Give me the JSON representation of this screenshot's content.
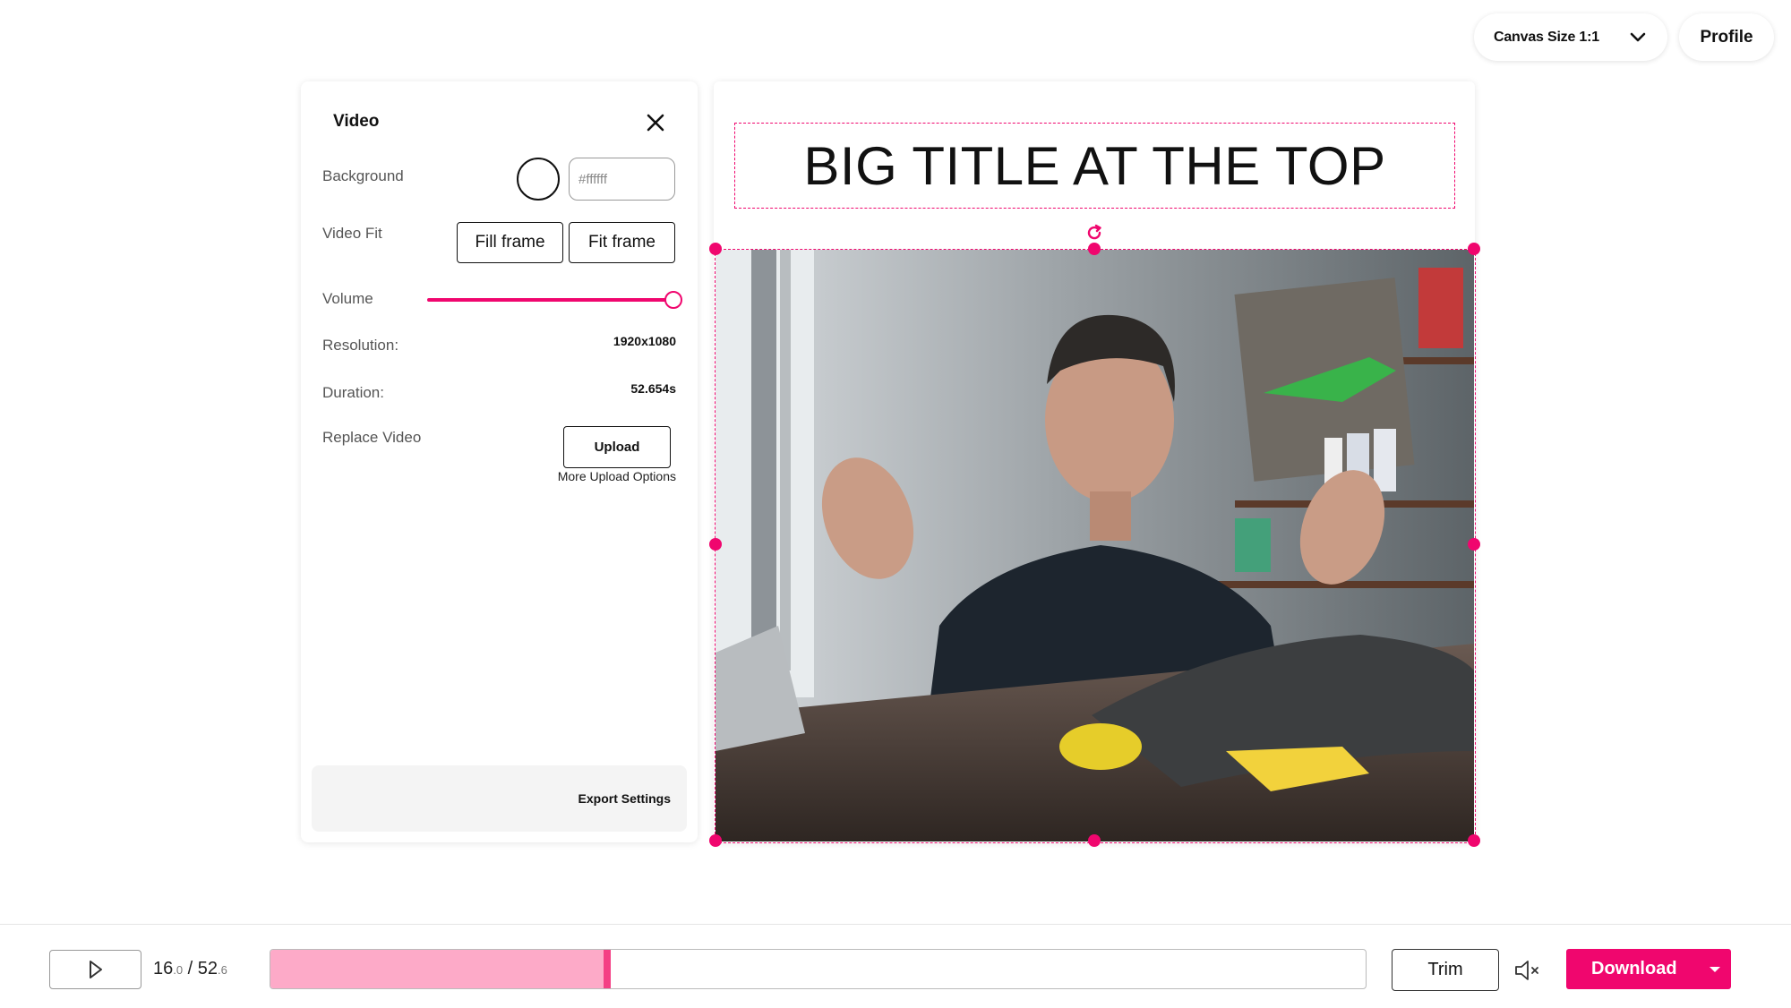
{
  "header": {
    "canvas_size_label": "Canvas Size 1:1",
    "profile_label": "Profile"
  },
  "panel": {
    "title": "Video",
    "background_label": "Background",
    "background_color_value": "#ffffff",
    "video_fit_label": "Video Fit",
    "fill_frame_label": "Fill frame",
    "fit_frame_label": "Fit frame",
    "volume_label": "Volume",
    "volume_level": 1.0,
    "resolution_label": "Resolution:",
    "resolution_value": "1920x1080",
    "duration_label": "Duration:",
    "duration_value": "52.654s",
    "replace_video_label": "Replace Video",
    "upload_label": "Upload",
    "more_upload_label": "More Upload Options",
    "export_settings_label": "Export Settings"
  },
  "canvas": {
    "title_text": "BIG TITLE AT THE TOP"
  },
  "player": {
    "current_main": "16",
    "current_frac": ".0",
    "separator": " / ",
    "total_main": "52",
    "total_frac": ".6",
    "progress_fraction": 0.304,
    "trim_label": "Trim",
    "download_label": "Download"
  },
  "colors": {
    "accent": "#f0066e",
    "timeline_fill": "#fdaac8",
    "playhead": "#f43f84"
  },
  "icons": {
    "dropdown": "chevron-down-icon",
    "close": "close-icon",
    "rotate": "rotate-icon",
    "play": "play-icon",
    "mute": "muted-speaker-icon",
    "download_caret": "caret-down-icon"
  }
}
